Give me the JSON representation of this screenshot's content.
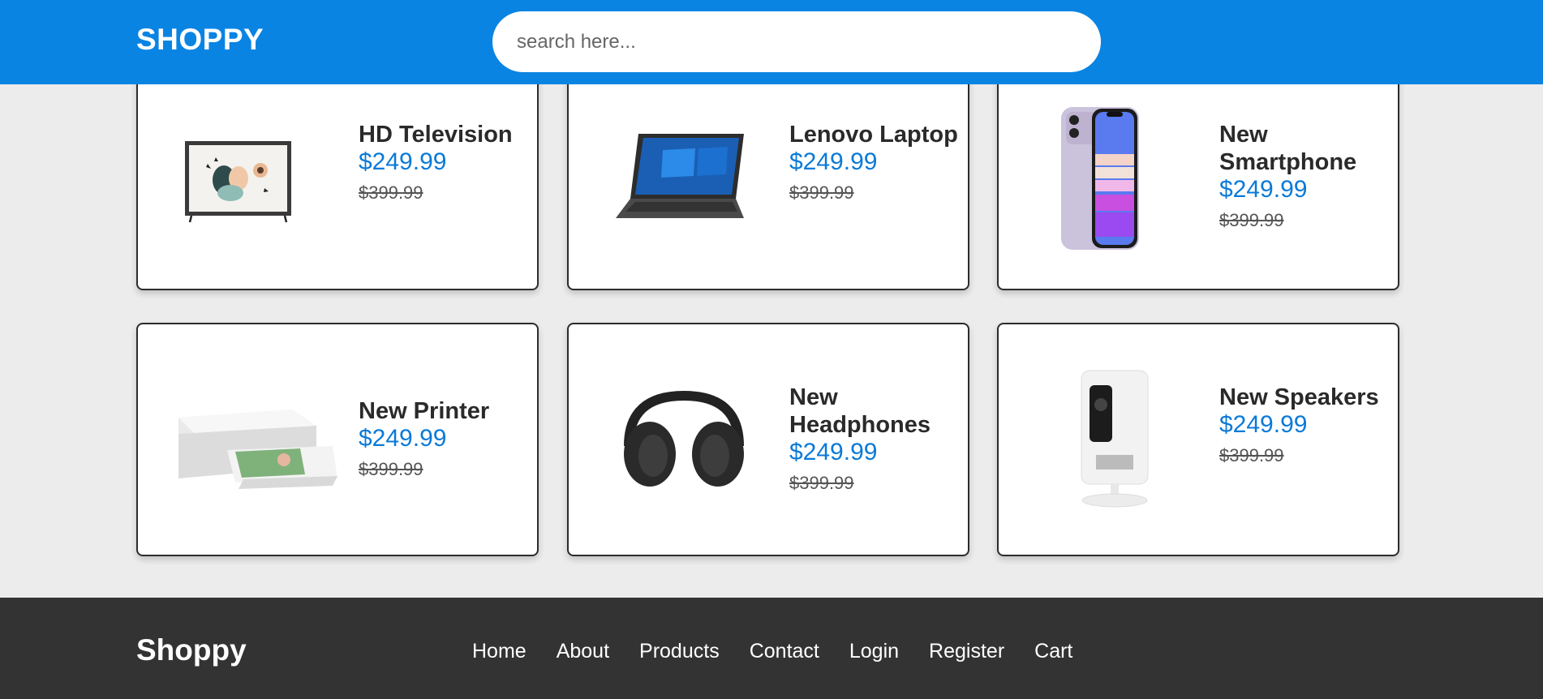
{
  "header": {
    "logo": "SHOPPY",
    "search_placeholder": "search here..."
  },
  "products": [
    {
      "name": "HD Television",
      "price": "$249.99",
      "old_price": "$399.99",
      "image": "tv-image"
    },
    {
      "name": "Lenovo Laptop",
      "price": "$249.99",
      "old_price": "$399.99",
      "image": "laptop-image"
    },
    {
      "name": "New Smartphone",
      "price": "$249.99",
      "old_price": "$399.99",
      "image": "smartphone-image"
    },
    {
      "name": "New Printer",
      "price": "$249.99",
      "old_price": "$399.99",
      "image": "printer-image"
    },
    {
      "name": "New Headphones",
      "price": "$249.99",
      "old_price": "$399.99",
      "image": "headphones-image"
    },
    {
      "name": "New Speakers",
      "price": "$249.99",
      "old_price": "$399.99",
      "image": "speaker-image"
    }
  ],
  "footer": {
    "logo": "Shoppy",
    "nav": [
      "Home",
      "About",
      "Products",
      "Contact",
      "Login",
      "Register",
      "Cart"
    ]
  },
  "colors": {
    "header_bg": "#0a84e3",
    "price": "#0a7ad8",
    "footer_bg": "#333333",
    "page_bg": "#ececec"
  }
}
